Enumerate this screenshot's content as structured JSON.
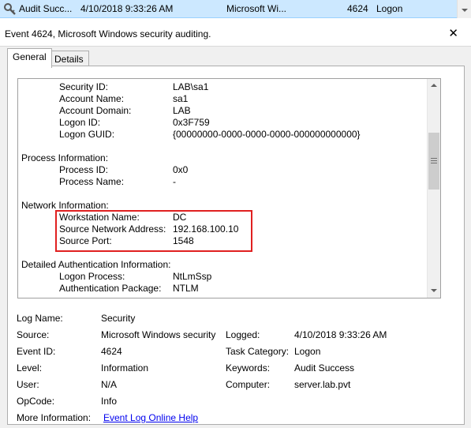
{
  "list_row": {
    "level": "Audit Succ...",
    "date": "4/10/2018 9:33:26 AM",
    "source": "Microsoft Wi...",
    "event_id": "4624",
    "category": "Logon"
  },
  "header": {
    "title": "Event 4624, Microsoft Windows security auditing.",
    "close_icon": "close-icon"
  },
  "tabs": [
    {
      "label": "General",
      "active": true
    },
    {
      "label": "Details",
      "active": false
    }
  ],
  "description": {
    "subject_fields": [
      {
        "label": "Security ID:",
        "value": "LAB\\sa1"
      },
      {
        "label": "Account Name:",
        "value": "sa1"
      },
      {
        "label": "Account Domain:",
        "value": "LAB"
      },
      {
        "label": "Logon ID:",
        "value": "0x3F759"
      },
      {
        "label": "Logon GUID:",
        "value": "{00000000-0000-0000-0000-000000000000}"
      }
    ],
    "process_heading": "Process Information:",
    "process_fields": [
      {
        "label": "Process ID:",
        "value": "0x0"
      },
      {
        "label": "Process Name:",
        "value": "-"
      }
    ],
    "network_heading": "Network Information:",
    "network_fields": [
      {
        "label": "Workstation Name:",
        "value": "DC"
      },
      {
        "label": "Source Network Address:",
        "value": "192.168.100.10"
      },
      {
        "label": "Source Port:",
        "value": "1548"
      }
    ],
    "auth_heading": "Detailed Authentication Information:",
    "auth_fields": [
      {
        "label": "Logon Process:",
        "value": "NtLmSsp"
      },
      {
        "label": "Authentication Package:",
        "value": "NTLM"
      }
    ]
  },
  "properties": {
    "log_name": {
      "label": "Log Name:",
      "value": "Security"
    },
    "source": {
      "label": "Source:",
      "value": "Microsoft Windows security"
    },
    "logged": {
      "label": "Logged:",
      "value": "4/10/2018 9:33:26 AM"
    },
    "event_id": {
      "label": "Event ID:",
      "value": "4624"
    },
    "task_category": {
      "label": "Task Category:",
      "value": "Logon"
    },
    "level": {
      "label": "Level:",
      "value": "Information"
    },
    "keywords": {
      "label": "Keywords:",
      "value": "Audit Success"
    },
    "user": {
      "label": "User:",
      "value": "N/A"
    },
    "computer": {
      "label": "Computer:",
      "value": "server.lab.pvt"
    },
    "opcode": {
      "label": "OpCode:",
      "value": "Info"
    },
    "more_info": {
      "label": "More Information:",
      "link": "Event Log Online Help"
    }
  },
  "colors": {
    "selection": "#cce8ff",
    "highlight_box": "#e02020",
    "link": "#0000ee"
  }
}
